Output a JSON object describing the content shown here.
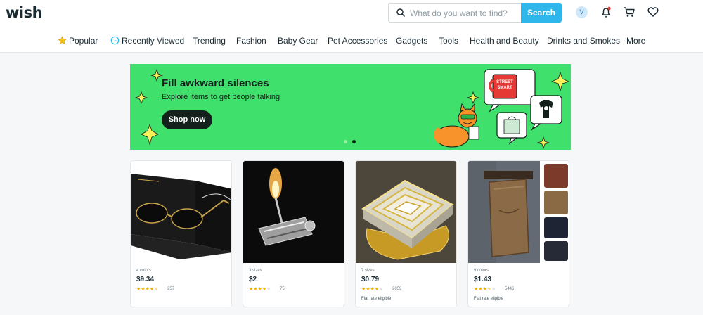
{
  "header": {
    "logo": "wish",
    "search": {
      "placeholder": "What do you want to find?",
      "button_label": "Search"
    },
    "avatar_initial": "V",
    "icons": [
      "bell-icon",
      "cart-icon",
      "heart-icon"
    ],
    "accent_color": "#2fb7ec"
  },
  "nav": {
    "items": [
      {
        "label": "Popular",
        "icon": "star-icon"
      },
      {
        "label": "Recently Viewed",
        "icon": "clock-icon"
      },
      {
        "label": "Trending"
      },
      {
        "label": "Fashion"
      },
      {
        "label": "Baby Gear"
      },
      {
        "label": "Pet Accessories"
      },
      {
        "label": "Gadgets"
      },
      {
        "label": "Tools"
      },
      {
        "label": "Health and Beauty"
      },
      {
        "label": "Drinks and Smokes"
      },
      {
        "label": "More"
      }
    ]
  },
  "banner": {
    "title": "Fill awkward silences",
    "subtitle": "Explore items to get people talking",
    "cta": "Shop now",
    "mug_text": "STREET SMART",
    "slides": 2,
    "active_slide": 2,
    "background": "#3fe06c"
  },
  "products": [
    {
      "variant": "4 colors",
      "price": "$9.34",
      "rating": 4.5,
      "reviews": "257",
      "image": "sunglasses-image"
    },
    {
      "variant": "3 sizes",
      "price": "$2",
      "rating": 4,
      "reviews": "75",
      "image": "match-lighter-image"
    },
    {
      "variant": "7 sizes",
      "price": "$0.79",
      "rating": 4,
      "reviews": "2059",
      "shipping": "Flat rate eligible",
      "image": "gold-ring-image"
    },
    {
      "variant": "9 colors",
      "price": "$1.43",
      "rating": 3.5,
      "reviews": "5446",
      "shipping": "Flat rate eligible",
      "image": "leather-phone-holster-image"
    }
  ]
}
